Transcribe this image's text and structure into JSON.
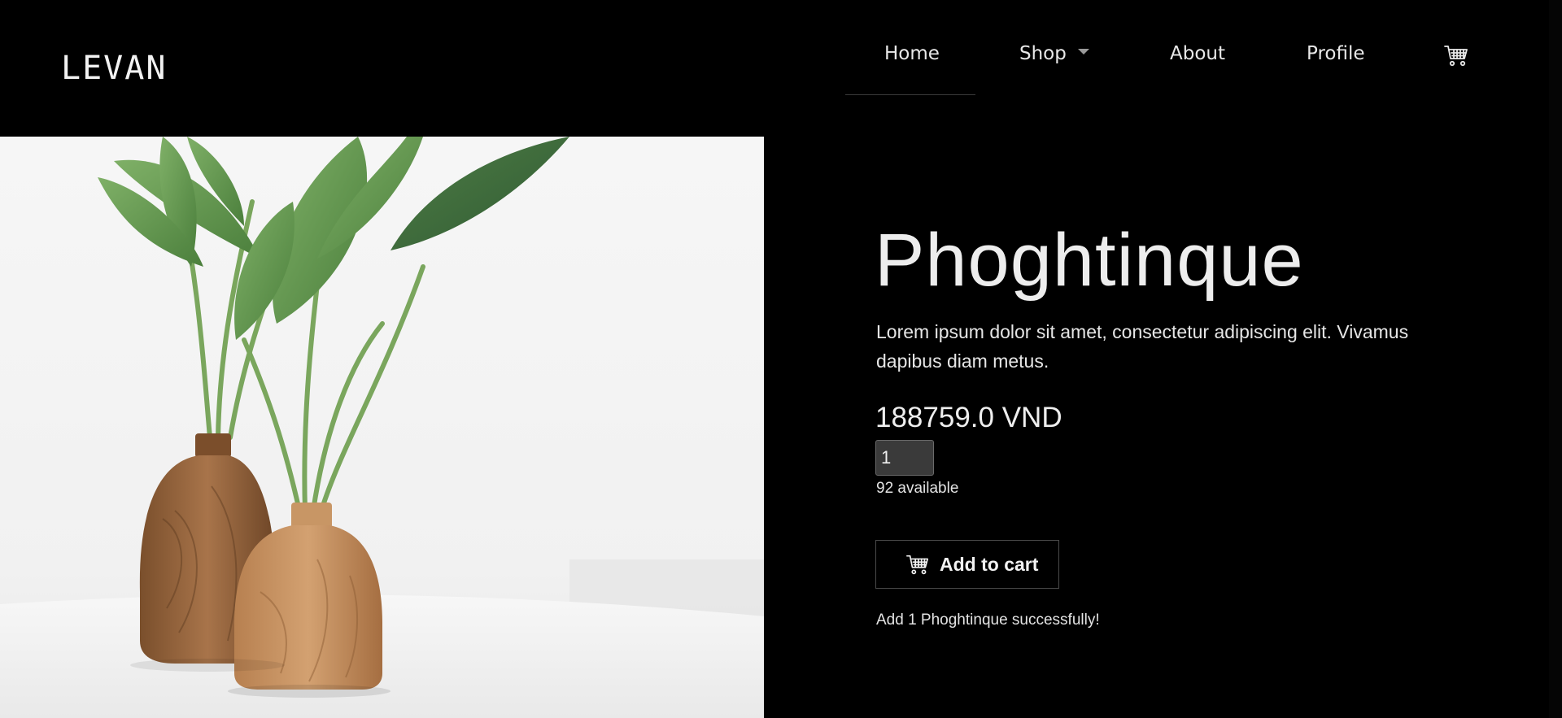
{
  "brand": {
    "logo_text": "LEVAN"
  },
  "nav": {
    "items": [
      {
        "label": "Home",
        "active": true
      },
      {
        "label": "Shop",
        "has_dropdown": true
      },
      {
        "label": "About"
      },
      {
        "label": "Profile"
      }
    ],
    "cart_icon": "cart-icon"
  },
  "hero": {
    "image_subject": "green plant leaves in two wooden vases on white table"
  },
  "product": {
    "name": "Phoghtinque",
    "description": "Lorem ipsum dolor sit amet, consectetur adipiscing elit. Vivamus dapibus diam metus.",
    "price": "188759.0 VND",
    "quantity_value": "1",
    "available_text": "92 available",
    "add_to_cart_label": "Add to cart",
    "status_message": "Add 1 Phoghtinque successfully!"
  },
  "colors": {
    "background": "#000000",
    "text": "#e9e9e9",
    "input_bg": "#3a3a3a",
    "leaf_green": "#5e9a4e",
    "wood": "#b07a4a"
  }
}
